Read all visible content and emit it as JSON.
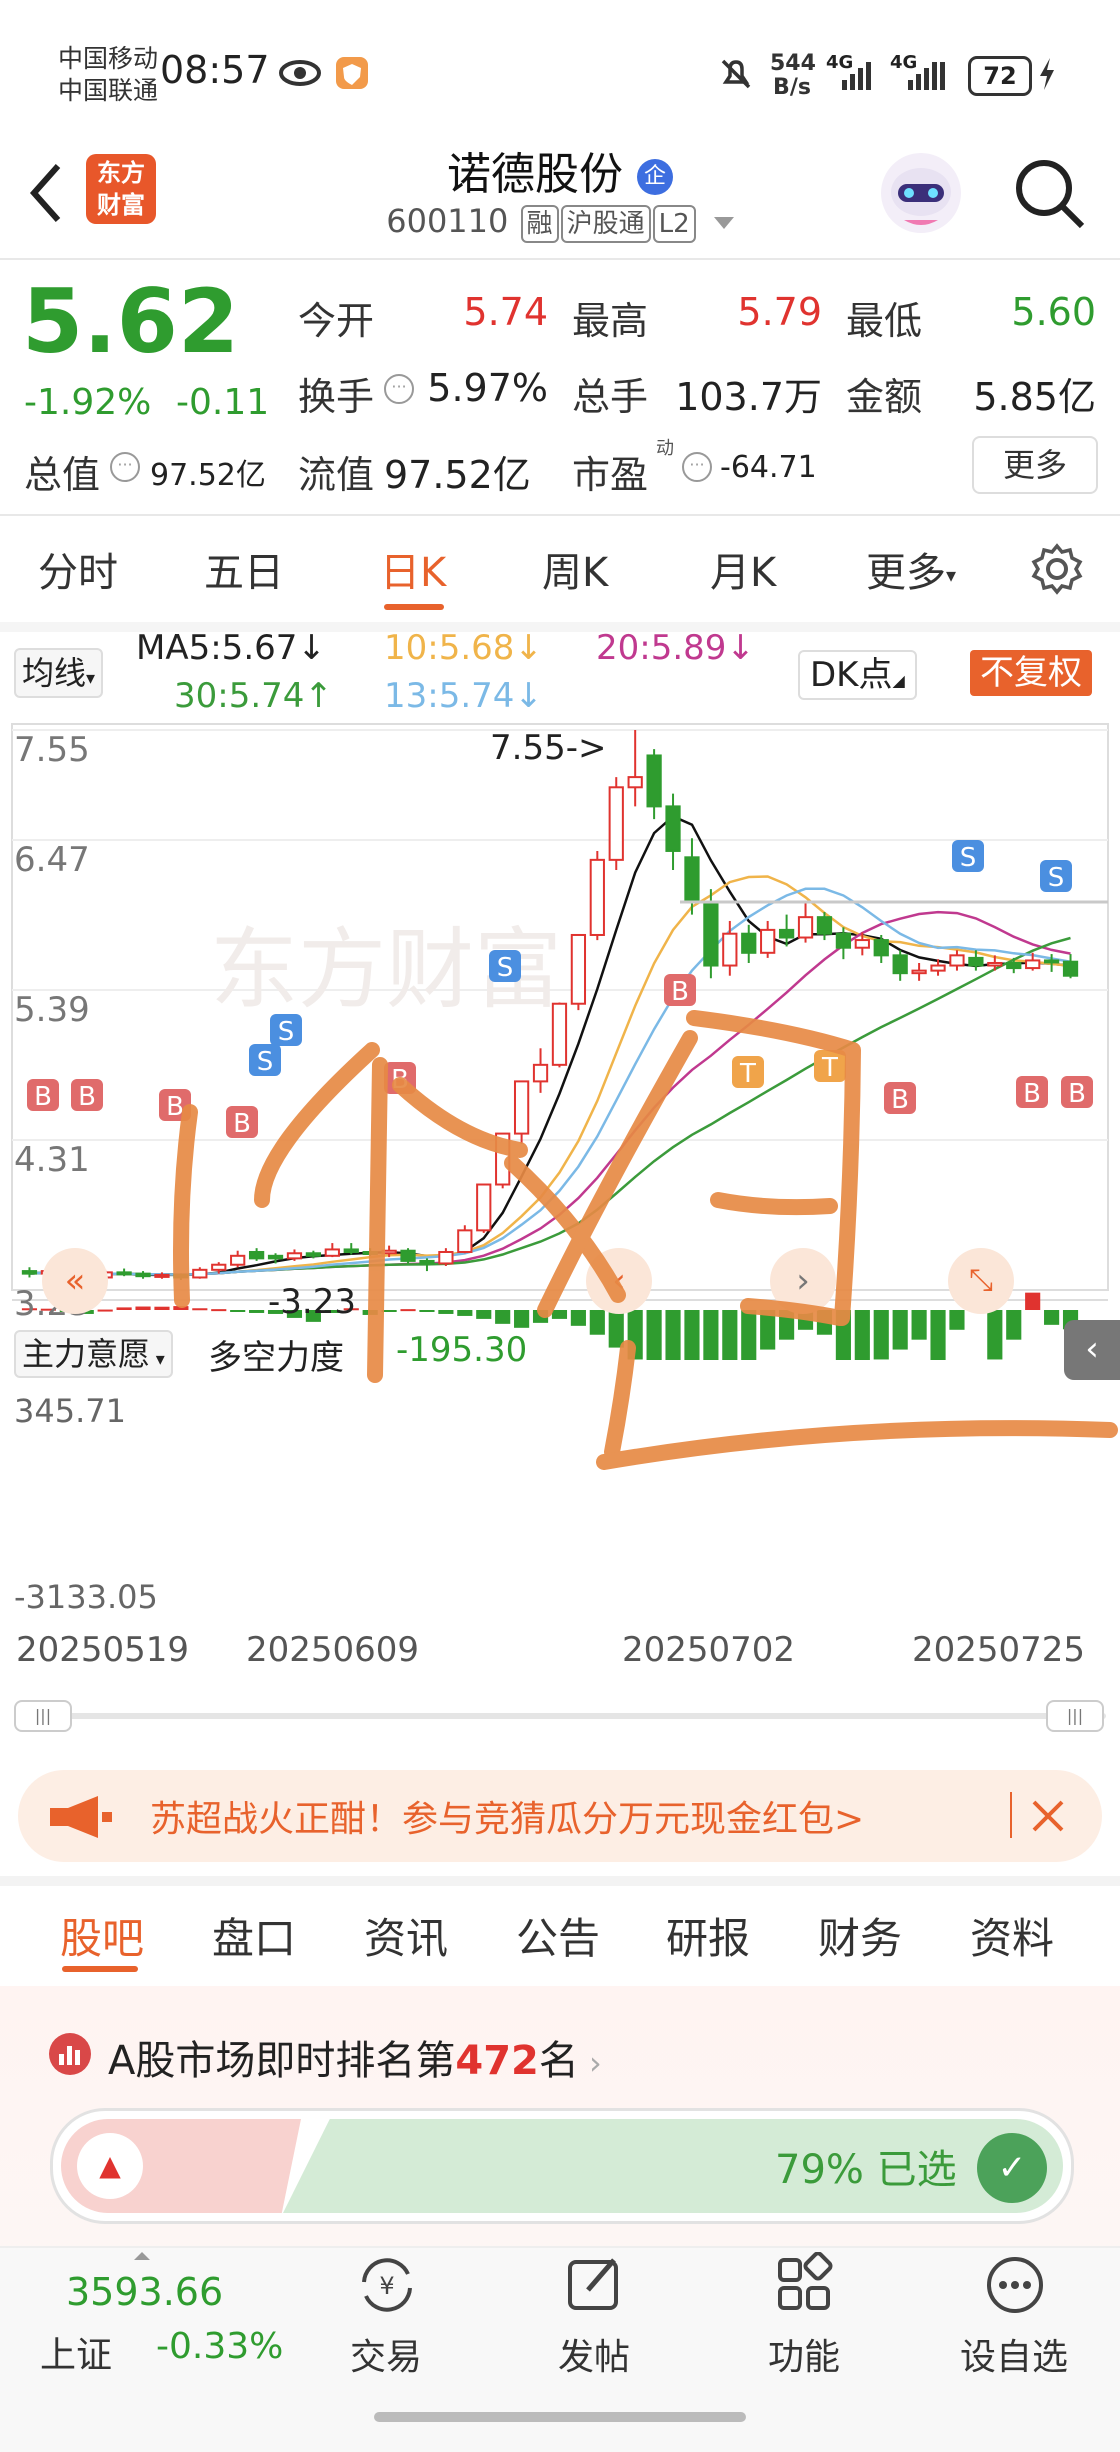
{
  "status_bar": {
    "carrier1": "中国移动",
    "carrier2": "中国联通",
    "time": "08:57",
    "net_speed_top": "544",
    "net_speed_bottom": "B/s",
    "net1": "4G",
    "net2": "4G",
    "battery": "72"
  },
  "header": {
    "logo_line1": "东方",
    "logo_line2": "财富",
    "title": "诺德股份",
    "title_badge": "企",
    "code": "600110",
    "tags": [
      "融",
      "沪股通",
      "L2"
    ]
  },
  "quote": {
    "price": "5.62",
    "change_pct": "-1.92%",
    "change": "-0.11",
    "open_label": "今开",
    "open": "5.74",
    "high_label": "最高",
    "high": "5.79",
    "low_label": "最低",
    "low": "5.60",
    "turnover_label": "换手",
    "turnover": "5.97%",
    "volume_label": "总手",
    "volume": "103.7万",
    "amount_label": "金额",
    "amount": "5.85亿",
    "mktcap_label": "总值",
    "mktcap": "97.52亿",
    "float_label": "流值",
    "float": "97.52亿",
    "pe_label": "市盈",
    "pe_sup": "动",
    "pe": "-64.71",
    "more_button": "更多"
  },
  "tabs": [
    "分时",
    "五日",
    "日K",
    "周K",
    "月K",
    "更多"
  ],
  "active_tab": "日K",
  "ma_legend": {
    "selector": "均线",
    "ma5": "MA5:5.67↓",
    "ma10": "10:5.68↓",
    "ma20": "20:5.89↓",
    "ma30": "30:5.74↑",
    "ma13": "13:5.74↓",
    "dk_button": "DK点",
    "adjust_button": "不复权"
  },
  "chart_labels": {
    "y_ticks": [
      "7.55",
      "6.47",
      "5.39",
      "4.31",
      "3.23"
    ],
    "max_annotation": "7.55->",
    "min_annotation": "-3.23",
    "indicator_selector": "主力意愿",
    "indicator_name": "多空力度",
    "indicator_value": "-195.30",
    "ind_top": "345.71",
    "ind_bottom": "-3133.05",
    "dates": [
      "20250519",
      "20250609",
      "20250702",
      "20250725"
    ],
    "buy_mark": "B",
    "sell_mark": "S",
    "t_mark": "T"
  },
  "chart_data": {
    "type": "candlestick",
    "ylim": [
      3.23,
      7.55
    ],
    "candles": [
      {
        "o": 3.3,
        "c": 3.28,
        "h": 3.33,
        "l": 3.25
      },
      {
        "o": 3.28,
        "c": 3.3,
        "h": 3.32,
        "l": 3.26
      },
      {
        "o": 3.3,
        "c": 3.27,
        "h": 3.31,
        "l": 3.25
      },
      {
        "o": 3.27,
        "c": 3.25,
        "h": 3.29,
        "l": 3.23
      },
      {
        "o": 3.25,
        "c": 3.29,
        "h": 3.31,
        "l": 3.24
      },
      {
        "o": 3.29,
        "c": 3.28,
        "h": 3.32,
        "l": 3.26
      },
      {
        "o": 3.28,
        "c": 3.26,
        "h": 3.3,
        "l": 3.24
      },
      {
        "o": 3.26,
        "c": 3.27,
        "h": 3.29,
        "l": 3.24
      },
      {
        "o": 3.27,
        "c": 3.25,
        "h": 3.28,
        "l": 3.23
      },
      {
        "o": 3.25,
        "c": 3.31,
        "h": 3.33,
        "l": 3.24
      },
      {
        "o": 3.31,
        "c": 3.35,
        "h": 3.37,
        "l": 3.28
      },
      {
        "o": 3.35,
        "c": 3.42,
        "h": 3.46,
        "l": 3.33
      },
      {
        "o": 3.45,
        "c": 3.4,
        "h": 3.48,
        "l": 3.38
      },
      {
        "o": 3.42,
        "c": 3.4,
        "h": 3.44,
        "l": 3.36
      },
      {
        "o": 3.4,
        "c": 3.44,
        "h": 3.47,
        "l": 3.38
      },
      {
        "o": 3.44,
        "c": 3.42,
        "h": 3.46,
        "l": 3.4
      },
      {
        "o": 3.42,
        "c": 3.47,
        "h": 3.52,
        "l": 3.41
      },
      {
        "o": 3.47,
        "c": 3.45,
        "h": 3.52,
        "l": 3.43
      },
      {
        "o": 3.45,
        "c": 3.44,
        "h": 3.48,
        "l": 3.42
      },
      {
        "o": 3.44,
        "c": 3.46,
        "h": 3.5,
        "l": 3.41
      },
      {
        "o": 3.46,
        "c": 3.38,
        "h": 3.48,
        "l": 3.36
      },
      {
        "o": 3.38,
        "c": 3.36,
        "h": 3.4,
        "l": 3.3
      },
      {
        "o": 3.36,
        "c": 3.45,
        "h": 3.48,
        "l": 3.34
      },
      {
        "o": 3.45,
        "c": 3.62,
        "h": 3.66,
        "l": 3.44
      },
      {
        "o": 3.62,
        "c": 3.98,
        "h": 3.98,
        "l": 3.6
      },
      {
        "o": 3.98,
        "c": 4.38,
        "h": 4.38,
        "l": 3.95
      },
      {
        "o": 4.38,
        "c": 4.79,
        "h": 4.79,
        "l": 4.3
      },
      {
        "o": 4.79,
        "c": 4.92,
        "h": 5.05,
        "l": 4.7
      },
      {
        "o": 4.92,
        "c": 5.4,
        "h": 5.41,
        "l": 4.9
      },
      {
        "o": 5.4,
        "c": 5.94,
        "h": 5.94,
        "l": 5.35
      },
      {
        "o": 5.94,
        "c": 6.53,
        "h": 6.6,
        "l": 5.9
      },
      {
        "o": 6.53,
        "c": 7.1,
        "h": 7.18,
        "l": 6.45
      },
      {
        "o": 7.1,
        "c": 7.18,
        "h": 7.55,
        "l": 6.95
      },
      {
        "o": 7.35,
        "c": 6.95,
        "h": 7.4,
        "l": 6.85
      },
      {
        "o": 6.95,
        "c": 6.6,
        "h": 7.05,
        "l": 6.45
      },
      {
        "o": 6.55,
        "c": 6.2,
        "h": 6.7,
        "l": 6.1
      },
      {
        "o": 6.2,
        "c": 5.7,
        "h": 6.3,
        "l": 5.6
      },
      {
        "o": 5.7,
        "c": 5.95,
        "h": 6.05,
        "l": 5.62
      },
      {
        "o": 5.95,
        "c": 5.8,
        "h": 6.02,
        "l": 5.72
      },
      {
        "o": 5.8,
        "c": 5.98,
        "h": 6.05,
        "l": 5.76
      },
      {
        "o": 5.98,
        "c": 5.92,
        "h": 6.1,
        "l": 5.85
      },
      {
        "o": 5.92,
        "c": 6.08,
        "h": 6.2,
        "l": 5.88
      },
      {
        "o": 6.08,
        "c": 5.95,
        "h": 6.12,
        "l": 5.9
      },
      {
        "o": 5.95,
        "c": 5.84,
        "h": 6.0,
        "l": 5.75
      },
      {
        "o": 5.84,
        "c": 5.9,
        "h": 5.96,
        "l": 5.78
      },
      {
        "o": 5.9,
        "c": 5.78,
        "h": 5.94,
        "l": 5.72
      },
      {
        "o": 5.78,
        "c": 5.64,
        "h": 5.82,
        "l": 5.58
      },
      {
        "o": 5.64,
        "c": 5.66,
        "h": 5.72,
        "l": 5.58
      },
      {
        "o": 5.66,
        "c": 5.7,
        "h": 5.75,
        "l": 5.62
      },
      {
        "o": 5.7,
        "c": 5.78,
        "h": 5.82,
        "l": 5.66
      },
      {
        "o": 5.76,
        "c": 5.7,
        "h": 5.82,
        "l": 5.66
      },
      {
        "o": 5.7,
        "c": 5.72,
        "h": 5.78,
        "l": 5.66
      },
      {
        "o": 5.72,
        "c": 5.68,
        "h": 5.76,
        "l": 5.64
      },
      {
        "o": 5.68,
        "c": 5.74,
        "h": 5.8,
        "l": 5.66
      },
      {
        "o": 5.74,
        "c": 5.73,
        "h": 5.79,
        "l": 5.65
      },
      {
        "o": 5.73,
        "c": 5.62,
        "h": 5.79,
        "l": 5.6
      }
    ],
    "indicator": [
      20,
      15,
      -10,
      -40,
      5,
      30,
      40,
      38,
      45,
      20,
      10,
      -15,
      -30,
      -40,
      -80,
      -120,
      -30,
      20,
      -50,
      -20,
      10,
      -10,
      -40,
      -60,
      -90,
      -140,
      -180,
      -130,
      -90,
      -160,
      -250,
      -380,
      -500,
      -2200,
      -3000,
      -1800,
      -3133,
      -900,
      -600,
      -400,
      -300,
      -200,
      -250,
      -1400,
      -900,
      -500,
      -400,
      -300,
      -600,
      -200,
      100,
      -500,
      -300,
      200,
      -150,
      -195
    ],
    "series": [
      {
        "name": "MA5",
        "color": "#111111"
      },
      {
        "name": "MA10",
        "color": "#f0b44a"
      },
      {
        "name": "MA20",
        "color": "#c0398f"
      },
      {
        "name": "MA30",
        "color": "#3b9b3b"
      },
      {
        "name": "MA13",
        "color": "#7bb9e6"
      }
    ]
  },
  "promo": {
    "text": "苏超战火正酣！参与竞猜瓜分万元现金红包>"
  },
  "subtabs": [
    "股吧",
    "盘口",
    "资讯",
    "公告",
    "研报",
    "财务",
    "资料"
  ],
  "active_subtab": "股吧",
  "rank": {
    "prefix": "A股市场即时排名第",
    "number": "472",
    "suffix": "名",
    "vote_text": "79% 已选"
  },
  "bottom_bar": {
    "index_value": "3593.66",
    "index_name": "上证",
    "index_change": "-0.33%",
    "items": [
      "交易",
      "发帖",
      "功能",
      "设自选"
    ]
  },
  "colors": {
    "up": "#e0332f",
    "down": "#2f9c2f",
    "accent": "#e8622c",
    "handwriting": "#e78a45"
  }
}
